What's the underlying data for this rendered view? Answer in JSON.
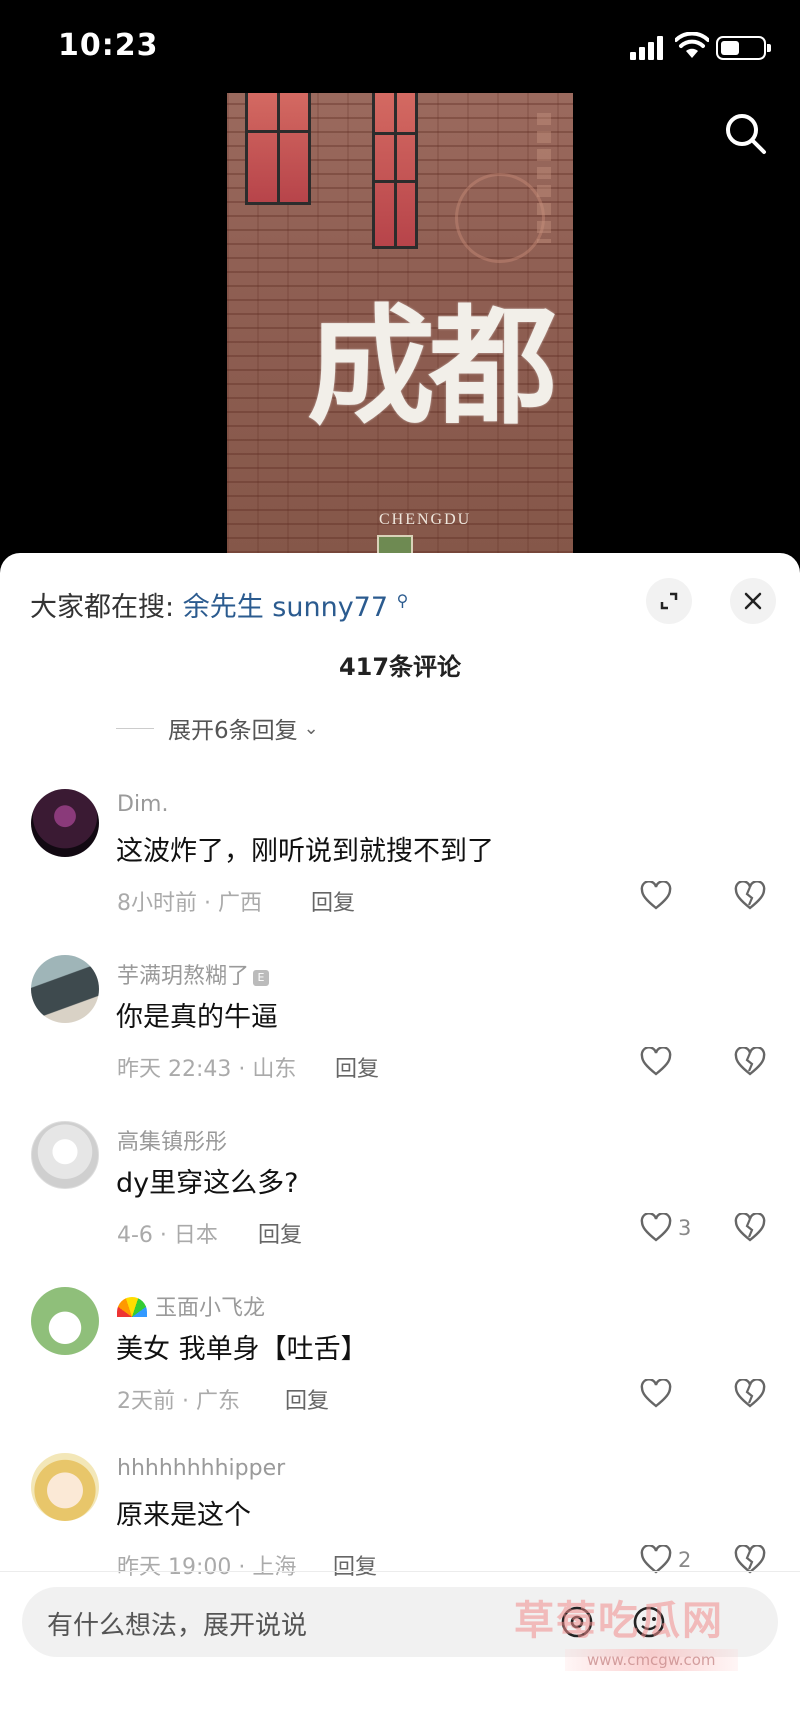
{
  "status_bar": {
    "time": "10:23"
  },
  "video": {
    "wall_text": "成都",
    "wall_subtext": "CHENGDU"
  },
  "trending": {
    "label": "大家都在搜:",
    "query": "余先生 sunny77"
  },
  "comments_count": "417条评论",
  "expand_replies": "展开6条回复",
  "comments": [
    {
      "username": "Dim.",
      "text": "这波炸了，刚听说到就搜不到了",
      "meta": "8小时前 · 广西",
      "reply": "回复",
      "likes": ""
    },
    {
      "username": "芋满玥熬糊了",
      "text": "你是真的牛逼",
      "meta": "昨天 22:43 · 山东",
      "reply": "回复",
      "likes": ""
    },
    {
      "username": "高集镇彤彤",
      "text": "dy里穿这么多?",
      "meta": "4-6 · 日本",
      "reply": "回复",
      "likes": "3"
    },
    {
      "username": "玉面小飞龙",
      "text": "美女 我单身【吐舌】",
      "meta": "2天前 · 广东",
      "reply": "回复",
      "likes": ""
    },
    {
      "username": "hhhhhhhhipper",
      "text": "原来是这个",
      "meta": "昨天 19:00 · 上海",
      "reply": "回复",
      "likes": "2"
    }
  ],
  "badge": "E",
  "input": {
    "placeholder": "有什么想法，展开说说"
  },
  "watermark": {
    "text": "草莓吃瓜网",
    "url": "www.cmcgw.com"
  },
  "icons": {
    "search": "search-icon",
    "expand": "expand-icon",
    "close": "close-icon",
    "heart": "heart-icon",
    "broken_heart": "dislike-icon",
    "at": "at-icon",
    "emoji": "emoji-icon",
    "rainbow": "rainbow-icon"
  },
  "colors": {
    "link": "#2b5b8f",
    "meta": "#aaaaaa",
    "sheet": "#ffffff"
  }
}
